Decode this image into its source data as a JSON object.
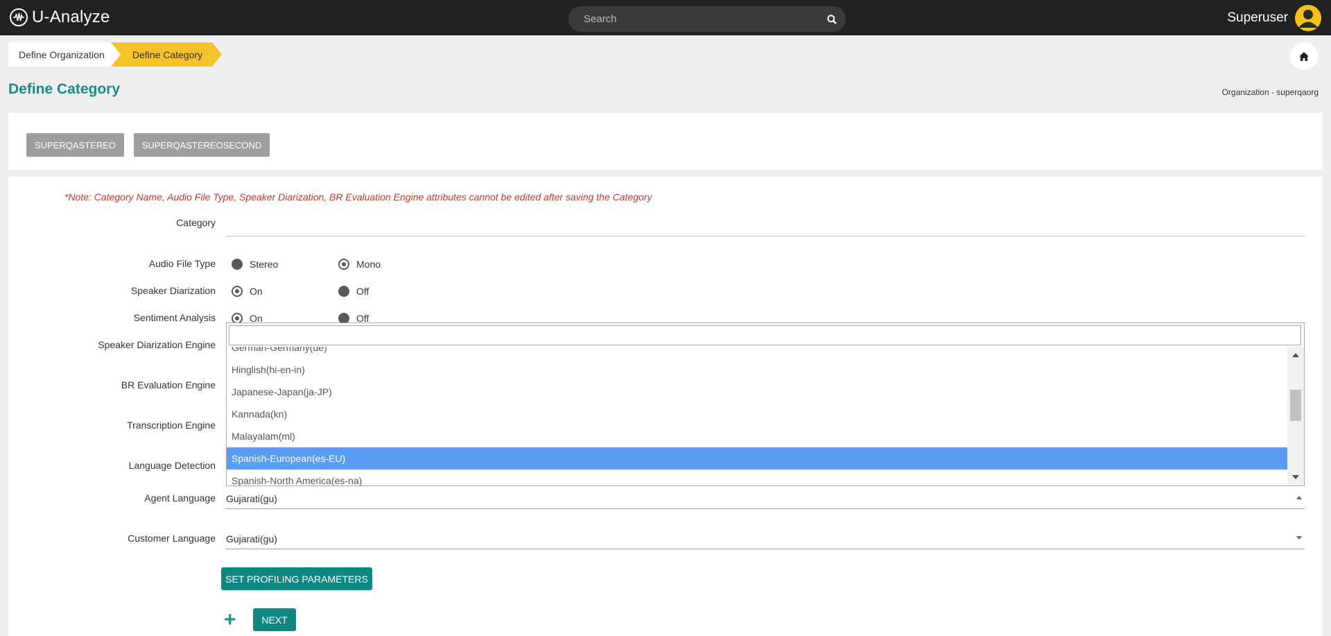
{
  "app": {
    "name": "U-Analyze"
  },
  "search": {
    "placeholder": "Search"
  },
  "user": {
    "name": "Superuser"
  },
  "breadcrumb": {
    "items": [
      "Define Organization",
      "Define Category"
    ]
  },
  "page": {
    "title": "Define Category",
    "org_label": "Organization - superqaorg"
  },
  "categories": [
    "SUPERQASTEREO",
    "SUPERQASTEREOSECOND"
  ],
  "form": {
    "note": "*Note: Category Name, Audio File Type, Speaker Diarization, BR Evaluation Engine attributes cannot be edited after saving the Category",
    "labels": {
      "category": "Category",
      "audio_file_type": "Audio File Type",
      "speaker_diarization": "Speaker Diarization",
      "sentiment_analysis": "Sentiment Analysis",
      "speaker_diarization_engine": "Speaker Diarization Engine",
      "br_evaluation_engine": "BR Evaluation Engine",
      "transcription_engine": "Transcription Engine",
      "language_detection": "Language Detection",
      "agent_language": "Agent Language",
      "customer_language": "Customer Language"
    },
    "category_value": "",
    "audio_file_type": {
      "options": [
        "Stereo",
        "Mono"
      ],
      "selected": "Mono"
    },
    "speaker_diarization": {
      "options": [
        "On",
        "Off"
      ],
      "selected": "On"
    },
    "sentiment_analysis": {
      "options": [
        "On",
        "Off"
      ],
      "selected": "On"
    },
    "agent_language": "Gujarati(gu)",
    "customer_language": "Gujarati(gu)",
    "set_profiling_label": "SET PROFILING PARAMETERS",
    "next_label": "NEXT"
  },
  "dropdown": {
    "search_value": "",
    "items": [
      "German-Germany(de)",
      "Hinglish(hi-en-in)",
      "Japanese-Japan(ja-JP)",
      "Kannada(kn)",
      "Malayalam(ml)",
      "Spanish-European(es-EU)",
      "Spanish-North America(es-na)"
    ],
    "selected": "Spanish-European(es-EU)"
  },
  "colors": {
    "accent": "#0f8783",
    "highlight": "#5b9cf5",
    "breadcrumb_active": "#f5c22a",
    "note": "#c0392b"
  }
}
